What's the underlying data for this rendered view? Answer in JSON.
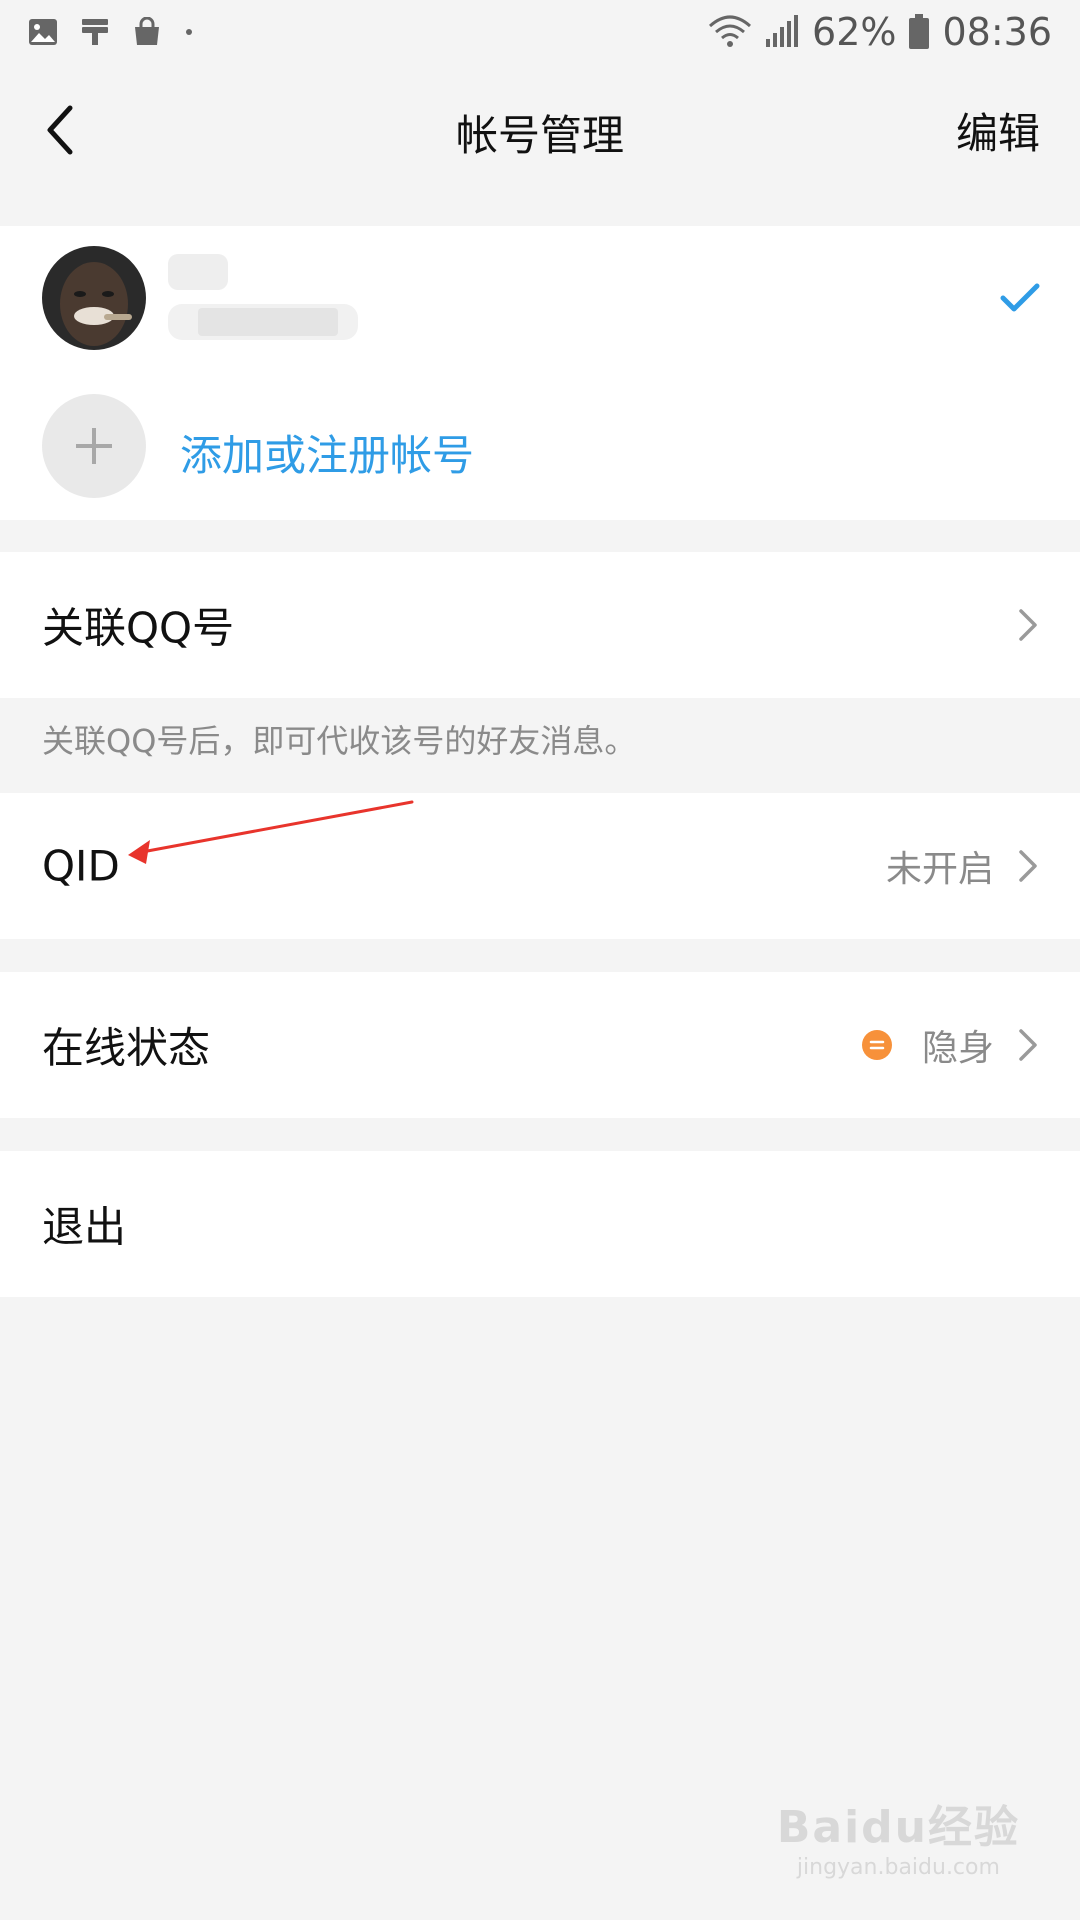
{
  "status_bar": {
    "left_icons": [
      "image-icon",
      "paint-roller-icon",
      "shopping-bag-icon",
      "dot-icon"
    ],
    "battery": "62%",
    "time": "08:36"
  },
  "navbar": {
    "back_icon": "chevron-left-icon",
    "title": "帐号管理",
    "edit_label": "编辑"
  },
  "account": {
    "selected": true,
    "add_label": "添加或注册帐号"
  },
  "rows": {
    "link_qq": {
      "label": "关联QQ号"
    },
    "link_qq_note": "关联QQ号后，即可代收该号的好友消息。",
    "qid": {
      "label": "QID",
      "value": "未开启"
    },
    "online_status": {
      "label": "在线状态",
      "value": "隐身",
      "dot_color": "#f7913a"
    },
    "logout": {
      "label": "退出"
    }
  },
  "watermark": {
    "brand": "Baidu经验",
    "url": "jingyan.baidu.com"
  },
  "colors": {
    "accent": "#2f9ce6",
    "background": "#f4f4f4",
    "annotation": "#e8342c"
  }
}
